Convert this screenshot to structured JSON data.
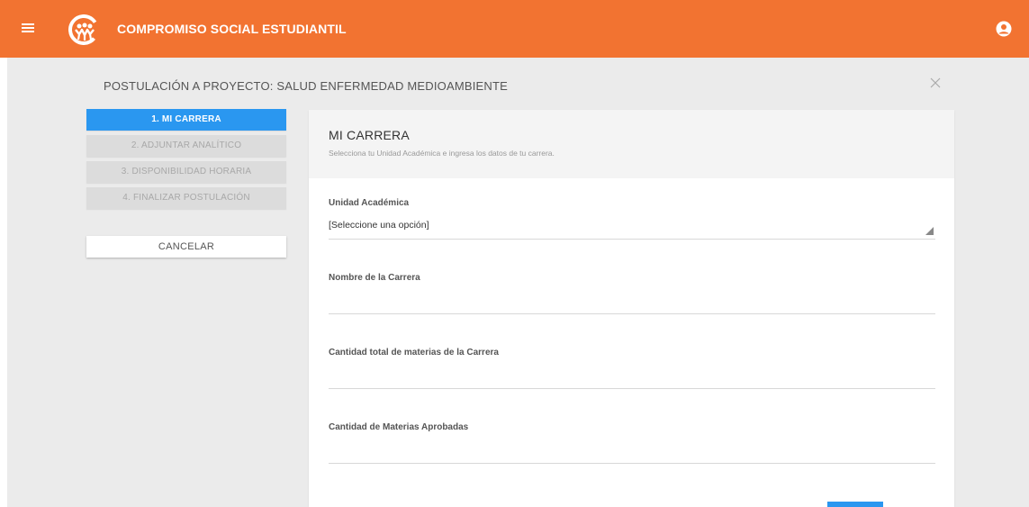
{
  "header": {
    "app_title": "COMPROMISO SOCIAL ESTUDIANTIL",
    "menu_icon": "hamburger-menu-icon",
    "user_icon": "account-circle-icon",
    "brand_color": "#f27331"
  },
  "page": {
    "title": "POSTULACIÓN A PROYECTO: SALUD ENFERMEDAD MEDIOAMBIENTE",
    "close_icon": "close-icon"
  },
  "steps": [
    {
      "label": "1. MI CARRERA",
      "active": true
    },
    {
      "label": "2. ADJUNTAR ANALÍTICO",
      "active": false
    },
    {
      "label": "3. DISPONIBILIDAD HORARIA",
      "active": false
    },
    {
      "label": "4. FINALIZAR POSTULACIÓN",
      "active": false
    }
  ],
  "cancel_label": "CANCELAR",
  "card": {
    "title": "MI CARRERA",
    "subtitle": "Selecciona tu Unidad Académica e ingresa los datos de tu carrera.",
    "fields": {
      "unidad": {
        "label": "Unidad Académica",
        "value": "[Seleccione una opción]"
      },
      "nombre": {
        "label": "Nombre de la Carrera",
        "value": ""
      },
      "total": {
        "label": "Cantidad total de materias de la Carrera",
        "value": ""
      },
      "aprobadas": {
        "label": "Cantidad de Materias Aprobadas",
        "value": ""
      }
    }
  },
  "accent_color": "#2a97f0"
}
